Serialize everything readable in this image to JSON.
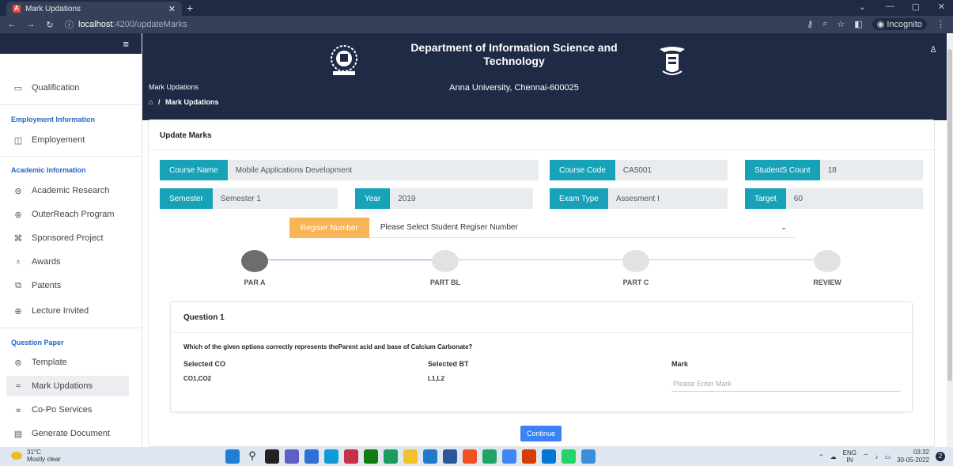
{
  "browser": {
    "tab_title": "Mark Updations",
    "tab_favicon": "A",
    "url_host": "localhost",
    "url_path": ":4200/updateMarks",
    "incognito_label": "Incognito"
  },
  "sidebar": {
    "items": [
      {
        "label": "Qualification",
        "icon": "▭"
      },
      {
        "label": "Employement",
        "icon": "◫"
      },
      {
        "label": "Academic Research",
        "icon": "⊜"
      },
      {
        "label": "OuterReach Program",
        "icon": "⊛"
      },
      {
        "label": "Sponsored Project",
        "icon": "⌘"
      },
      {
        "label": "Awards",
        "icon": "♁"
      },
      {
        "label": "Patents",
        "icon": "⧉"
      },
      {
        "label": "Lecture Invited",
        "icon": "⊕"
      },
      {
        "label": "Template",
        "icon": "⊚"
      },
      {
        "label": "Mark Updations",
        "icon": "≈"
      },
      {
        "label": "Co-Po Services",
        "icon": "∝"
      },
      {
        "label": "Generate Document",
        "icon": "▤"
      }
    ],
    "sections": {
      "employment": "Employment Information",
      "academic": "Academic Information",
      "question": "Question Paper"
    }
  },
  "header": {
    "page_title": "Mark Updations",
    "breadcrumb_current": "Mark Updations",
    "breadcrumb_sep": "/",
    "department": "Department of Information Science and Technology",
    "university": "Anna University, Chennai-600025"
  },
  "card": {
    "title": "Update Marks",
    "fields": {
      "course_name_label": "Course Name",
      "course_name": "Mobile Applications Development",
      "course_code_label": "Course Code",
      "course_code": "CA5001",
      "student_count_label": "StudentS Count",
      "student_count": "18",
      "semester_label": "Semester",
      "semester": "Semester 1",
      "year_label": "Year",
      "year": "2019",
      "exam_type_label": "Exam Type",
      "exam_type": "Assesment I",
      "target_label": "Target",
      "target": "60"
    },
    "register_label": "Regiser Number",
    "register_placeholder": "Please Select Student Regiser Number",
    "steps": [
      "PAR A",
      "PART BL",
      "PART C",
      "REVIEW"
    ],
    "active_step": 1
  },
  "question": {
    "title": "Question 1",
    "text": "Which of the given options correctly represents theParent acid and base of Calcium Carbonate?",
    "co_label": "Selected CO",
    "co_value": "CO1,CO2",
    "bt_label": "Selected BT",
    "bt_value": "L1,L2",
    "mark_label": "Mark",
    "mark_placeholder": "Please Enter Mark"
  },
  "continue_label": "Continue",
  "taskbar": {
    "temperature": "31°C",
    "weather": "Mostly clear",
    "lang": "ENG",
    "region": "IN",
    "time": "03:32",
    "date": "30-05-2022"
  },
  "colors": {
    "header_bg": "#1f2a44",
    "label_teal": "#17a2b8",
    "label_orange": "#f7b557",
    "accent_blue": "#3b82f6"
  }
}
